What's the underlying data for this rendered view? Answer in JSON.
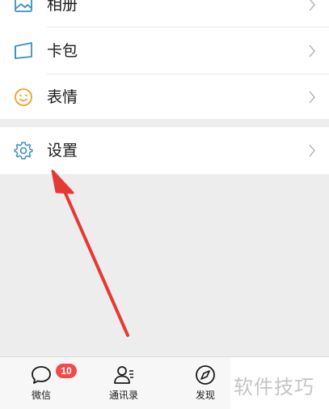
{
  "menu": {
    "items": [
      {
        "label": "相册",
        "icon": "album-icon"
      },
      {
        "label": "卡包",
        "icon": "card-wallet-icon"
      },
      {
        "label": "表情",
        "icon": "emoji-icon"
      }
    ],
    "settings": {
      "label": "设置",
      "icon": "gear-icon"
    }
  },
  "tabbar": {
    "tabs": [
      {
        "label": "微信",
        "icon": "chat-bubble-icon",
        "badge": "10"
      },
      {
        "label": "通讯录",
        "icon": "contacts-icon"
      },
      {
        "label": "发现",
        "icon": "compass-icon"
      }
    ]
  },
  "watermark": "软件技巧",
  "colors": {
    "accent": "#1aad19",
    "icon_blue": "#3b8fc4",
    "emoji_orange": "#f0a020",
    "badge": "#f04b4b",
    "arrow": "#e53935"
  }
}
